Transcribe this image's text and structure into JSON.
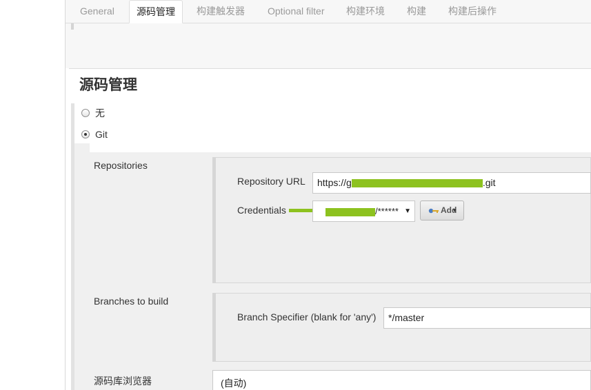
{
  "tabs": [
    {
      "label": "General",
      "active": false
    },
    {
      "label": "源码管理",
      "active": true
    },
    {
      "label": "构建触发器",
      "active": false
    },
    {
      "label": "Optional filter",
      "active": false
    },
    {
      "label": "构建环境",
      "active": false
    },
    {
      "label": "构建",
      "active": false
    },
    {
      "label": "构建后操作",
      "active": false
    }
  ],
  "scm": {
    "title": "源码管理",
    "options": [
      {
        "label": "无",
        "selected": false
      },
      {
        "label": "Git",
        "selected": true
      }
    ]
  },
  "repositories": {
    "label": "Repositories",
    "url_label": "Repository URL",
    "url_prefix": "https://g",
    "url_suffix": ".git",
    "credentials_label": "Credentials",
    "credentials_value": "/******",
    "add_button": "Add",
    "add_caret": "▾",
    "select_arrow": "▼"
  },
  "branches": {
    "label": "Branches to build",
    "specifier_label": "Branch Specifier (blank for 'any')",
    "specifier_value": "*/master"
  },
  "browser": {
    "label": "源码库浏览器",
    "value": "(自动)"
  },
  "colors": {
    "redaction": "#8dc21f",
    "panel": "#f0f0f0",
    "tab_inactive": "#9a9a9a"
  }
}
